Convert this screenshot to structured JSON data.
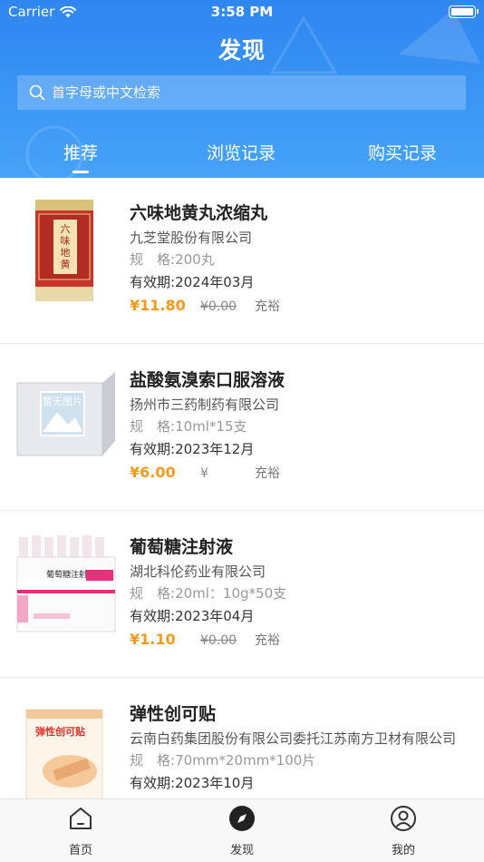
{
  "status_bar": {
    "carrier": "Carrier",
    "time": "3:58 PM"
  },
  "nav": {
    "title": "发现"
  },
  "search": {
    "placeholder": "首字母或中文检索"
  },
  "tabs": [
    {
      "label": "推荐",
      "active": true
    },
    {
      "label": "浏览记录",
      "active": false
    },
    {
      "label": "购买记录",
      "active": false
    }
  ],
  "products": [
    {
      "name": "六味地黄丸浓缩丸",
      "manufacturer": "九芝堂股份有限公司",
      "spec_label": "规　格:",
      "spec": "200丸",
      "expiry_label": "有效期:",
      "expiry": "2024年03月",
      "price": "¥11.80",
      "old_price": "¥0.00",
      "stock": "充裕",
      "thumb": "liuwei-box"
    },
    {
      "name": "盐酸氨溴索口服溶液",
      "manufacturer": "扬州市三药制药有限公司",
      "spec_label": "规　格:",
      "spec": "10ml*15支",
      "expiry_label": "有效期:",
      "expiry": "2023年12月",
      "price": "¥6.00",
      "old_price": "¥",
      "stock": "充裕",
      "thumb": "no-image-placeholder",
      "thumb_text": "暂无图片"
    },
    {
      "name": "葡萄糖注射液",
      "manufacturer": "湖北科伦药业有限公司",
      "spec_label": "规　格:",
      "spec": "20ml：10g*50支",
      "expiry_label": "有效期:",
      "expiry": "2023年04月",
      "price": "¥1.10",
      "old_price": "¥0.00",
      "stock": "充裕",
      "thumb": "glucose-box",
      "thumb_text": "葡萄糖注射液"
    },
    {
      "name": "弹性创可贴",
      "manufacturer": "云南白药集团股份有限公司委托江苏南方卫材有限公司",
      "spec_label": "规　格:",
      "spec": "70mm*20mm*100片",
      "expiry_label": "有效期:",
      "expiry": "2023年10月",
      "price": "",
      "old_price": "",
      "stock": "",
      "thumb": "bandage-box",
      "thumb_text": "弹性创可贴"
    }
  ],
  "tabbar": [
    {
      "label": "首页",
      "icon": "home-icon"
    },
    {
      "label": "发现",
      "icon": "compass-icon",
      "active": true
    },
    {
      "label": "我的",
      "icon": "user-icon"
    }
  ],
  "colors": {
    "header": "#2f86f0",
    "price": "#f39a1b"
  }
}
